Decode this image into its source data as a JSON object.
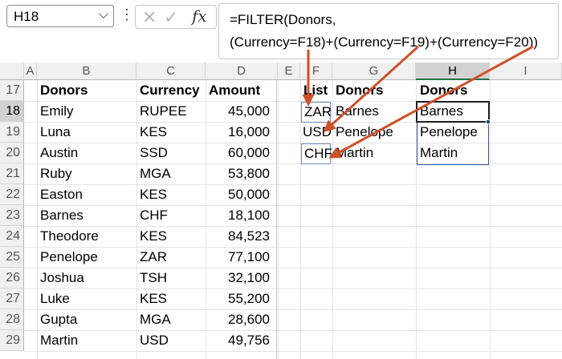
{
  "formula_bar": {
    "name_box": "H18",
    "name_box_chevron": "chevron-down-icon",
    "more_icon": "vertical-ellipsis-icon",
    "cancel_icon": "close-icon",
    "enter_icon": "check-icon",
    "fx_label": "fx",
    "formula_line1": "=FILTER(Donors,",
    "formula_line2": "(Currency=F18)+(Currency=F19)+(Currency=F20))"
  },
  "sheet": {
    "columns": [
      "A",
      "B",
      "C",
      "D",
      "E",
      "F",
      "G",
      "H",
      "I"
    ],
    "selected_column": "H",
    "rows": [
      "17",
      "18",
      "19",
      "20",
      "21",
      "22",
      "23",
      "24",
      "25",
      "26",
      "27",
      "28",
      "29"
    ],
    "selected_row": "18",
    "table": {
      "headers": [
        "Donors",
        "Currency",
        "Amount"
      ],
      "rows": [
        [
          "Emily",
          "RUPEE",
          "45,000"
        ],
        [
          "Luna",
          "KES",
          "16,000"
        ],
        [
          "Austin",
          "SSD",
          "60,000"
        ],
        [
          "Ruby",
          "MGA",
          "53,800"
        ],
        [
          "Easton",
          "KES",
          "50,000"
        ],
        [
          "Barnes",
          "CHF",
          "18,100"
        ],
        [
          "Theodore",
          "KES",
          "84,523"
        ],
        [
          "Penelope",
          "ZAR",
          "77,100"
        ],
        [
          "Joshua",
          "TSH",
          "32,100"
        ],
        [
          "Luke",
          "KES",
          "55,200"
        ],
        [
          "Gupta",
          "MGA",
          "28,600"
        ],
        [
          "Martin",
          "USD",
          "49,756"
        ]
      ]
    },
    "list": {
      "header": "List",
      "values": [
        "ZAR",
        "USD",
        "CHF"
      ]
    },
    "g_column": {
      "header": "Donors",
      "values": [
        "Barnes",
        "Penelope",
        "Martin"
      ]
    },
    "h_column": {
      "header": "Donors",
      "values": [
        "Barnes",
        "Penelope",
        "Martin"
      ]
    }
  },
  "colors": {
    "arrow": "#d0502a",
    "selection_border": "#1f1f1f",
    "spill_border": "#2f5496",
    "header_bg": "#f0f0f0",
    "selected_header_bg": "#d2d2d2"
  }
}
